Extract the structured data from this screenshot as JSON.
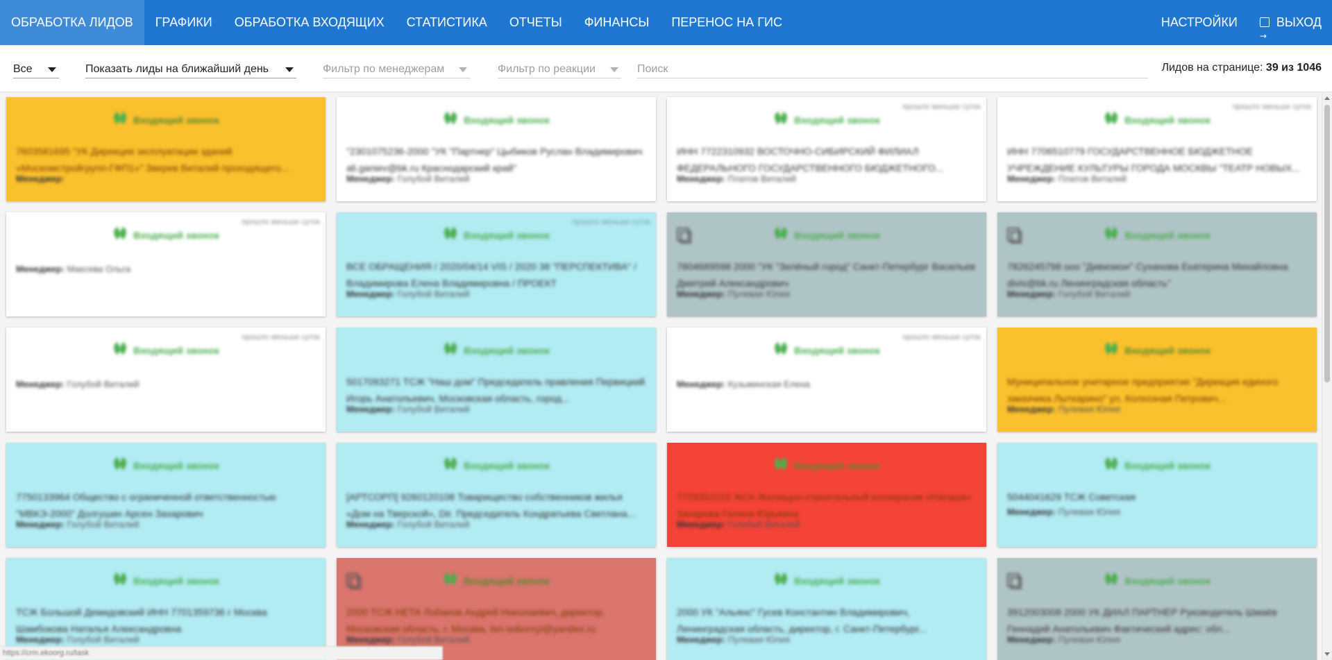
{
  "nav": {
    "items": [
      "ОБРАБОТКА ЛИДОВ",
      "ГРАФИКИ",
      "ОБРАБОТКА ВХОДЯЩИХ",
      "СТАТИСТИКА",
      "ОТЧЕТЫ",
      "ФИНАНСЫ",
      "ПЕРЕНОС НА ГИС"
    ],
    "active_index": 0,
    "settings": "НАСТРОЙКИ",
    "logout": "ВЫХОД"
  },
  "filters": {
    "scope": "Все",
    "period": "Показать лиды на ближайший день",
    "managers_placeholder": "Фильтр по менеджерам",
    "reaction_placeholder": "Фильтр по реакции",
    "search_placeholder": "Поиск",
    "count_label": "Лидов на странице:",
    "count_value": "39 из 1046"
  },
  "colors": {
    "nav": "#1e78d2",
    "white": "#ffffff",
    "blue": "#b2ebf2",
    "gray": "#b0c4c8",
    "yellow": "#fbc02d",
    "red": "#f44336",
    "rose": "#d9756d"
  },
  "card_common": {
    "title": "Входящий звонок",
    "manager_label": "Менеджер:",
    "badge": "прошло меньше суток"
  },
  "cards": [
    {
      "color": "yellow",
      "badge": false,
      "copy": false,
      "text": "7603581695 \"УК Дирекция эксплуатации зданий «Москомстройгрупп-ГФП1»\" Зверев Виталий проходящего...",
      "manager": ""
    },
    {
      "color": "white",
      "badge": false,
      "copy": false,
      "text": "\"2301075236-2000 \"УК \"Партнер\" Цыбиков Руслан Владимирович ali.ganiev@bk.ru Краснодарский край\"",
      "manager": "Голубой Виталий"
    },
    {
      "color": "white",
      "badge": true,
      "copy": false,
      "text": "ИНН 7722310932 ВОСТОЧНО-СИБИРСКИЙ ФИЛИАЛ ФЕДЕРАЛЬНОГО ГОСУДАРСТВЕННОГО БЮДЖЕТНОГО...",
      "manager": "Платов Виталий"
    },
    {
      "color": "white",
      "badge": true,
      "copy": false,
      "text": "ИНН 7706510779 ГОСУДАРСТВЕННОЕ БЮДЖЕТНОЕ УЧРЕЖДЕНИЕ КУЛЬТУРЫ ГОРОДА МОСКВЫ \"ТЕАТР НОВЫХ...",
      "manager": "Платов Виталий"
    },
    {
      "color": "white",
      "badge": true,
      "copy": false,
      "text": "",
      "manager": "Максева Ольга"
    },
    {
      "color": "blue",
      "badge": true,
      "copy": false,
      "text": "ВСЕ ОБРАЩЕНИЯ / 2020/04/14 VIS / 2020 38 \"ПЕРСПЕКТИВА\" / Владимирова Елена Владимировна / ПРОЕКТ",
      "manager": "Голубой Виталий"
    },
    {
      "color": "gray",
      "badge": false,
      "copy": true,
      "text": "7804689598 2000 \"УК \"Зелёный город\" Санкт-Петербург Васильев Дмитрий Александрович",
      "manager": "Пулевая Юлия"
    },
    {
      "color": "gray",
      "badge": false,
      "copy": true,
      "text": "7826245798 ооо \"Дивизион\" Суханова Екатерина Михайловна divis@bk.ru Ленинградская область\"",
      "manager": "Голубой Виталий"
    },
    {
      "color": "white",
      "badge": true,
      "copy": false,
      "text": "",
      "manager": "Голубой Виталий"
    },
    {
      "color": "blue",
      "badge": false,
      "copy": false,
      "text": "5017093271 ТСЖ \"Наш дом\" Председатель правления Первицкий Игорь Анатольевич, Московская область, город...",
      "manager": "Голубой Виталий"
    },
    {
      "color": "white",
      "badge": true,
      "copy": false,
      "text": "",
      "manager": "Кузьминская Елена"
    },
    {
      "color": "yellow",
      "badge": false,
      "copy": false,
      "text": "Муниципальное унитарное предприятие \"Дирекция единого заказчика Лыткарино\" ул. Колхозная Петрович...",
      "manager": "Пулевая Юлия"
    },
    {
      "color": "blue",
      "badge": false,
      "copy": false,
      "text": "7750133964 Общество с ограниченной ответственностью \"МВКЭ-2000\" Долгушин Арсен Захарович",
      "manager": "Голубой Виталий"
    },
    {
      "color": "blue",
      "badge": false,
      "copy": false,
      "text": "[АРТСОРП] 9260120108 Товарищество собственников жилья «Дом на Тверской», Dir. Председатель Кондратьева Светлана...",
      "manager": "Голубой Виталий"
    },
    {
      "color": "red",
      "badge": false,
      "copy": false,
      "text": "7729352222 ЖСК Жилищно-строительный кооператив «Наташа» Захарова Галина Юрьевна",
      "manager": "Голубой Виталий"
    },
    {
      "color": "blue",
      "badge": false,
      "copy": false,
      "text": "5044041629 ТСЖ Советская",
      "manager": "Пулевая Юлия"
    },
    {
      "color": "blue",
      "badge": false,
      "copy": false,
      "text": "ТСЖ Большой Демидовский ИНН 7701359736 г Москва Шамбокова Наталья Александровна",
      "manager": "Голубой Виталий"
    },
    {
      "color": "rose",
      "badge": false,
      "copy": true,
      "text": "2000 ТСЖ НЕТА Лобанов Андрей Николаевич, директор, Московская область, г. Москва, tsn-sobornyi@yandex.ru",
      "manager": "Голубой Виталий"
    },
    {
      "color": "blue",
      "badge": false,
      "copy": false,
      "text": "2000 УК \"Альянс\" Гусев Константин Владимирович, Ленинградская область, директор, г. Санкт-Петербург...",
      "manager": "Пулевая Юлия"
    },
    {
      "color": "gray",
      "badge": false,
      "copy": true,
      "text": "3912003008 2000 УК ДИАЛ ПАРТНЕР Руководитель Шмаёв Геннадий Анатольевич Фактический адрес: обл...",
      "manager": "Пулевая Юлия"
    }
  ],
  "status_url": "https://crm.ekoorg.ru/task"
}
